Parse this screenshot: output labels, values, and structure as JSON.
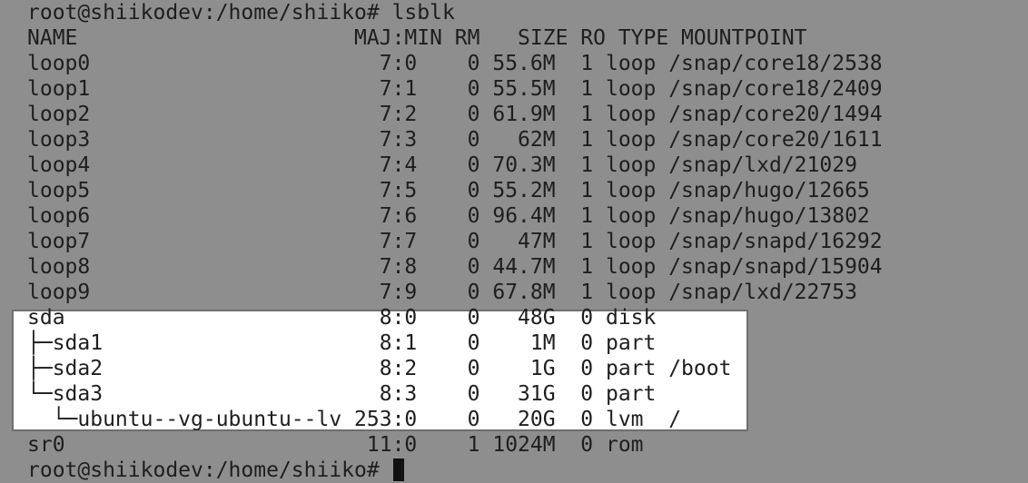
{
  "terminal": {
    "prompt": "root@shiikodev:/home/shiiko# ",
    "command": "lsblk",
    "header": "NAME                      MAJ:MIN RM   SIZE RO TYPE MOUNTPOINT",
    "rows": [
      "loop0                       7:0    0 55.6M  1 loop /snap/core18/2538",
      "loop1                       7:1    0 55.5M  1 loop /snap/core18/2409",
      "loop2                       7:2    0 61.9M  1 loop /snap/core20/1494",
      "loop3                       7:3    0   62M  1 loop /snap/core20/1611",
      "loop4                       7:4    0 70.3M  1 loop /snap/lxd/21029",
      "loop5                       7:5    0 55.2M  1 loop /snap/hugo/12665",
      "loop6                       7:6    0 96.4M  1 loop /snap/hugo/13802",
      "loop7                       7:7    0   47M  1 loop /snap/snapd/16292",
      "loop8                       7:8    0 44.7M  1 loop /snap/snapd/15904",
      "loop9                       7:9    0 67.8M  1 loop /snap/lxd/22753",
      "sda                         8:0    0   48G  0 disk",
      "├─sda1                      8:1    0    1M  0 part",
      "├─sda2                      8:2    0    1G  0 part /boot",
      "└─sda3                      8:3    0   31G  0 part",
      "  └─ubuntu--vg-ubuntu--lv 253:0    0   20G  0 lvm  /",
      "sr0                        11:0    1 1024M  0 rom"
    ],
    "final_prompt": "root@shiikodev:/home/shiiko# "
  },
  "colors": {
    "background": "#8e8e8e",
    "text": "#1e1e1e",
    "highlight": "#ffffff",
    "cursor": "#111111"
  }
}
